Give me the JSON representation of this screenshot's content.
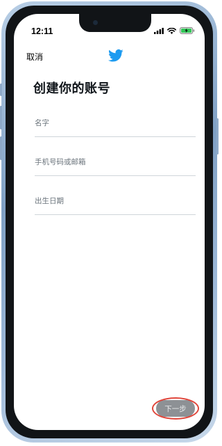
{
  "status_bar": {
    "time": "12:11"
  },
  "nav": {
    "cancel_label": "取消",
    "logo_icon": "twitter-bird-icon",
    "brand_color": "#1d9bf0"
  },
  "page": {
    "title": "创建你的账号"
  },
  "form": {
    "fields": [
      {
        "placeholder": "名字"
      },
      {
        "placeholder": "手机号码或邮箱"
      },
      {
        "placeholder": "出生日期"
      }
    ]
  },
  "actions": {
    "next_label": "下一步",
    "highlight_color": "#e0463b"
  }
}
